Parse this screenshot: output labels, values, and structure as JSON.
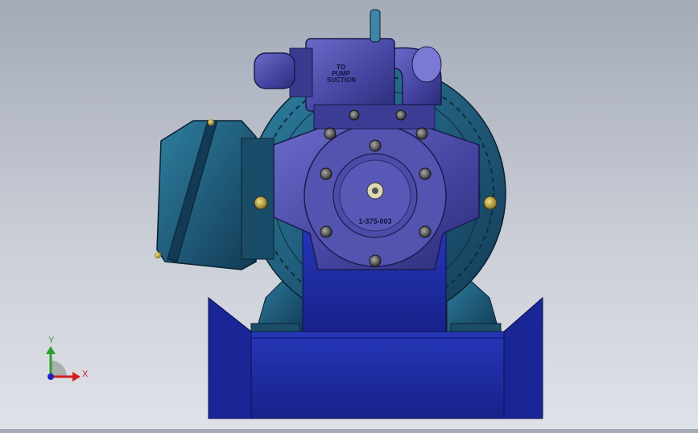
{
  "model": {
    "suction_label_line1": "TO",
    "suction_label_line2": "PUMP",
    "suction_label_line3": "SUCTION",
    "part_number": "1-375-003"
  },
  "triad": {
    "x_label": "X",
    "y_label": "Y"
  },
  "colors": {
    "background_top": "#a3aab8",
    "background_bottom": "#dfe2e8",
    "pump_body": "#4a4aa6",
    "motor_teal": "#1f5f7e",
    "base_navy": "#1c2aa0",
    "bolt_gold": "#c8b24a"
  }
}
